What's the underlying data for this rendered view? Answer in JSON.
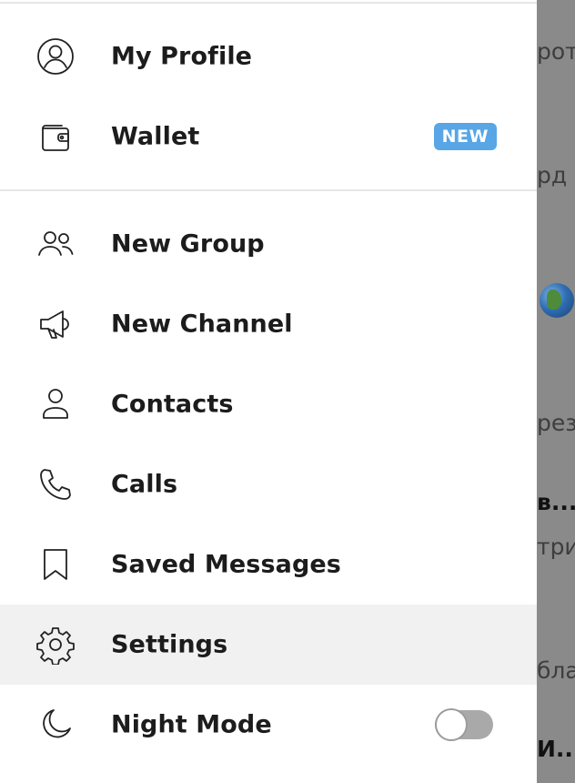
{
  "menu": {
    "items": [
      {
        "label": "My Profile",
        "icon": "user-circle-icon"
      },
      {
        "label": "Wallet",
        "icon": "wallet-icon",
        "badge": "NEW"
      },
      {
        "label": "New Group",
        "icon": "group-icon"
      },
      {
        "label": "New Channel",
        "icon": "megaphone-icon"
      },
      {
        "label": "Contacts",
        "icon": "person-icon"
      },
      {
        "label": "Calls",
        "icon": "phone-icon"
      },
      {
        "label": "Saved Messages",
        "icon": "bookmark-icon"
      },
      {
        "label": "Settings",
        "icon": "gear-icon",
        "active": true
      },
      {
        "label": "Night Mode",
        "icon": "moon-icon",
        "toggle": false
      }
    ]
  },
  "background_fragments": [
    "роть",
    "рд и",
    "рез",
    "в...",
    "три",
    "бла",
    "И..."
  ],
  "colors": {
    "badge": "#58a6e6",
    "active_row": "#f1f1f1",
    "overlay": "#8a8a8a"
  }
}
